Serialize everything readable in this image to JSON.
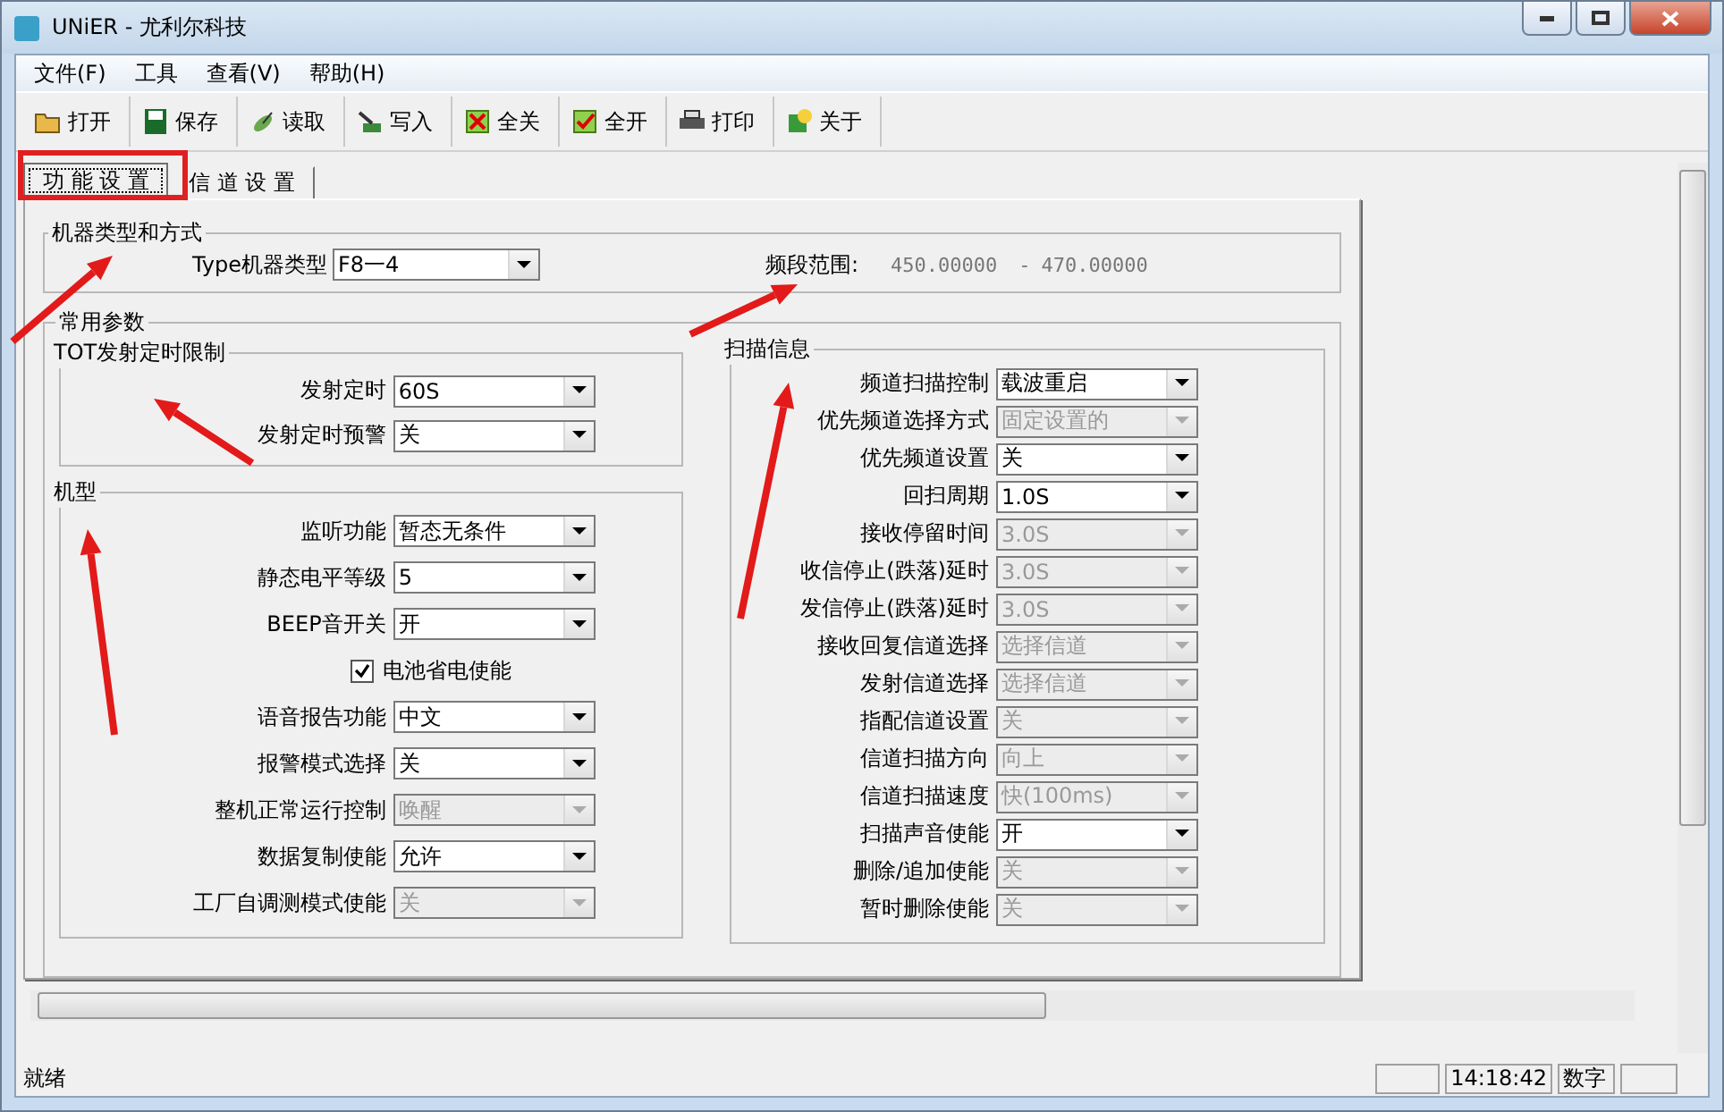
{
  "window": {
    "title": "UNiER - 尤利尔科技"
  },
  "menu": [
    {
      "label": "文件(F)"
    },
    {
      "label": "工具"
    },
    {
      "label": "查看(V)"
    },
    {
      "label": "帮助(H)"
    }
  ],
  "toolbar": [
    {
      "label": "打开",
      "kind": "open"
    },
    {
      "label": "保存",
      "kind": "save"
    },
    {
      "label": "读取",
      "kind": "read"
    },
    {
      "label": "写入",
      "kind": "write"
    },
    {
      "label": "全关",
      "kind": "alloff"
    },
    {
      "label": "全开",
      "kind": "allon"
    },
    {
      "label": "打印",
      "kind": "print"
    },
    {
      "label": "关于",
      "kind": "about"
    }
  ],
  "tabs": [
    {
      "label": "功 能 设 置",
      "selected": true
    },
    {
      "label": "信 道 设 置",
      "selected": false
    }
  ],
  "machine": {
    "title": "机器类型和方式",
    "type_label": "Type机器类型",
    "type_value": "F8一4",
    "band_label": "频段范围:",
    "band_from": "450.00000",
    "band_dash": "-",
    "band_to": "470.00000"
  },
  "common": {
    "title": "常用参数",
    "tot": {
      "title": "TOT发射定时限制",
      "rows": [
        {
          "kind": "combo",
          "label": "发射定时",
          "value": "60S",
          "disabled": false
        },
        {
          "kind": "combo",
          "label": "发射定时预警",
          "value": "关",
          "disabled": false
        }
      ]
    },
    "model": {
      "title": "机型",
      "rows": [
        {
          "kind": "combo",
          "label": "监听功能",
          "value": "暂态无条件",
          "disabled": false
        },
        {
          "kind": "combo",
          "label": "静态电平等级",
          "value": "5",
          "disabled": false
        },
        {
          "kind": "combo",
          "label": "BEEP音开关",
          "value": "开",
          "disabled": false
        },
        {
          "kind": "checkbox",
          "label": "电池省电使能",
          "checked": true
        },
        {
          "kind": "combo",
          "label": "语音报告功能",
          "value": "中文",
          "disabled": false
        },
        {
          "kind": "combo",
          "label": "报警模式选择",
          "value": "关",
          "disabled": false
        },
        {
          "kind": "combo",
          "label": "整机正常运行控制",
          "value": "唤醒",
          "disabled": true
        },
        {
          "kind": "combo",
          "label": "数据复制使能",
          "value": "允许",
          "disabled": false
        },
        {
          "kind": "combo",
          "label": "工厂自调测模式使能",
          "value": "关",
          "disabled": true
        }
      ]
    },
    "scan": {
      "title": "扫描信息",
      "rows": [
        {
          "kind": "combo",
          "label": "频道扫描控制",
          "value": "载波重启",
          "disabled": false
        },
        {
          "kind": "combo",
          "label": "优先频道选择方式",
          "value": "固定设置的",
          "disabled": true
        },
        {
          "kind": "combo",
          "label": "优先频道设置",
          "value": "关",
          "disabled": false
        },
        {
          "kind": "combo",
          "label": "回扫周期",
          "value": "1.0S",
          "disabled": false
        },
        {
          "kind": "combo",
          "label": "接收停留时间",
          "value": "3.0S",
          "disabled": true
        },
        {
          "kind": "combo",
          "label": "收信停止(跌落)延时",
          "value": "3.0S",
          "disabled": true
        },
        {
          "kind": "combo",
          "label": "发信停止(跌落)延时",
          "value": "3.0S",
          "disabled": true
        },
        {
          "kind": "combo",
          "label": "接收回复信道选择",
          "value": "选择信道",
          "disabled": true
        },
        {
          "kind": "combo",
          "label": "发射信道选择",
          "value": "选择信道",
          "disabled": true
        },
        {
          "kind": "combo",
          "label": "指配信道设置",
          "value": "关",
          "disabled": true
        },
        {
          "kind": "combo",
          "label": "信道扫描方向",
          "value": "向上",
          "disabled": true
        },
        {
          "kind": "combo",
          "label": "信道扫描速度",
          "value": "快(100ms)",
          "disabled": true
        },
        {
          "kind": "combo",
          "label": "扫描声音使能",
          "value": "开",
          "disabled": false
        },
        {
          "kind": "combo",
          "label": "删除/追加使能",
          "value": "关",
          "disabled": true
        },
        {
          "kind": "combo",
          "label": "暂时删除使能",
          "value": "关",
          "disabled": true
        }
      ]
    }
  },
  "status_bar": {
    "text": "就绪",
    "time": "14:18:42",
    "mode": "数字"
  }
}
